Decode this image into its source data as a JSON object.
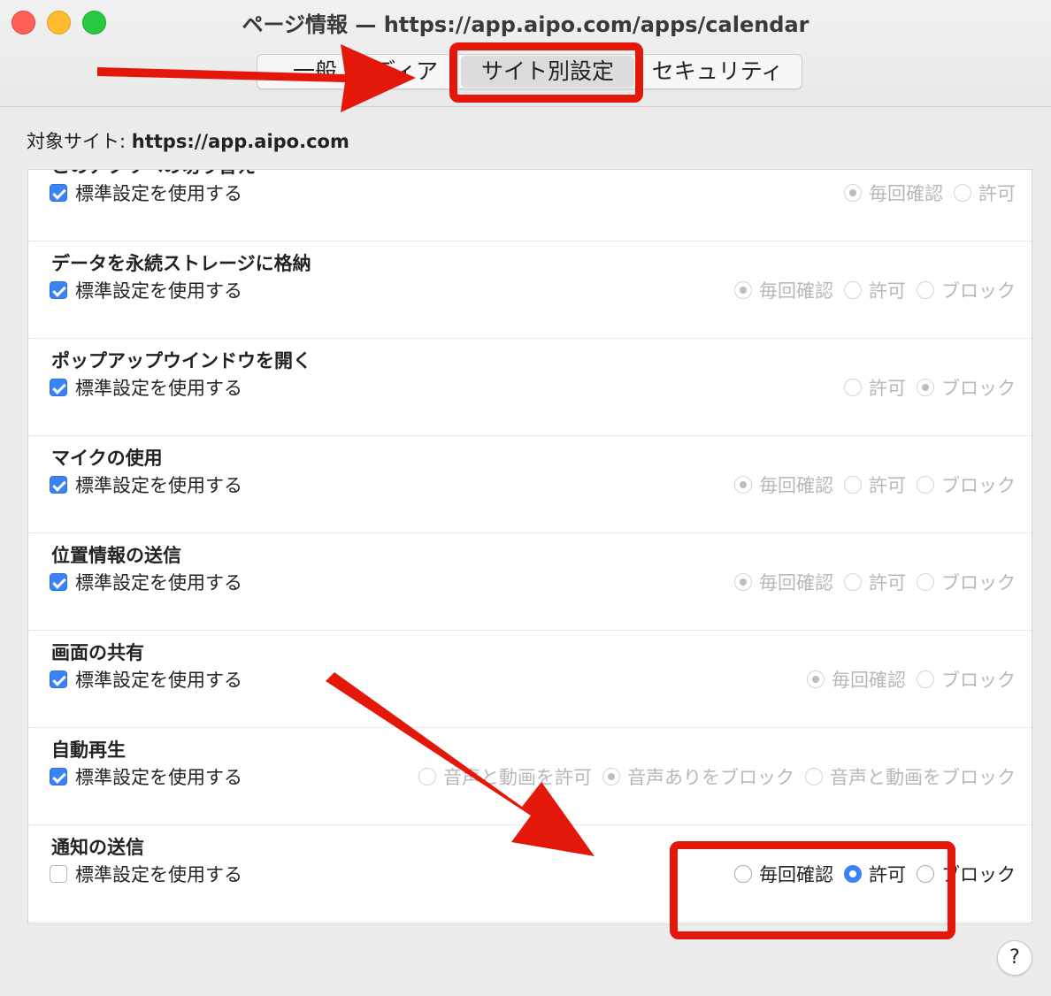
{
  "window": {
    "title": "ページ情報 — https://app.aipo.com/apps/calendar"
  },
  "tabs": [
    {
      "label": "一般"
    },
    {
      "label": "メディア"
    },
    {
      "label": "サイト別設定"
    },
    {
      "label": "セキュリティ"
    }
  ],
  "target": {
    "label": "対象サイト:",
    "url": "https://app.aipo.com"
  },
  "use_default_label": "標準設定を使用する",
  "permissions": [
    {
      "title": "このアプリへの切り替え",
      "default_checked": true,
      "options": [
        "毎回確認",
        "許可"
      ],
      "selected": 0
    },
    {
      "title": "データを永続ストレージに格納",
      "default_checked": true,
      "options": [
        "毎回確認",
        "許可",
        "ブロック"
      ],
      "selected": 0
    },
    {
      "title": "ポップアップウインドウを開く",
      "default_checked": true,
      "options": [
        "許可",
        "ブロック"
      ],
      "selected": 1
    },
    {
      "title": "マイクの使用",
      "default_checked": true,
      "options": [
        "毎回確認",
        "許可",
        "ブロック"
      ],
      "selected": 0
    },
    {
      "title": "位置情報の送信",
      "default_checked": true,
      "options": [
        "毎回確認",
        "許可",
        "ブロック"
      ],
      "selected": 0
    },
    {
      "title": "画面の共有",
      "default_checked": true,
      "options": [
        "毎回確認",
        "ブロック"
      ],
      "selected": 0
    },
    {
      "title": "自動再生",
      "default_checked": true,
      "options": [
        "音声と動画を許可",
        "音声ありをブロック",
        "音声と動画をブロック"
      ],
      "selected": 1
    },
    {
      "title": "通知の送信",
      "default_checked": false,
      "options": [
        "毎回確認",
        "許可",
        "ブロック"
      ],
      "selected": 1
    }
  ],
  "help": {
    "label": "?"
  },
  "colors": {
    "annotation_red": "#e3170a",
    "accent_blue": "#3b82f6"
  }
}
